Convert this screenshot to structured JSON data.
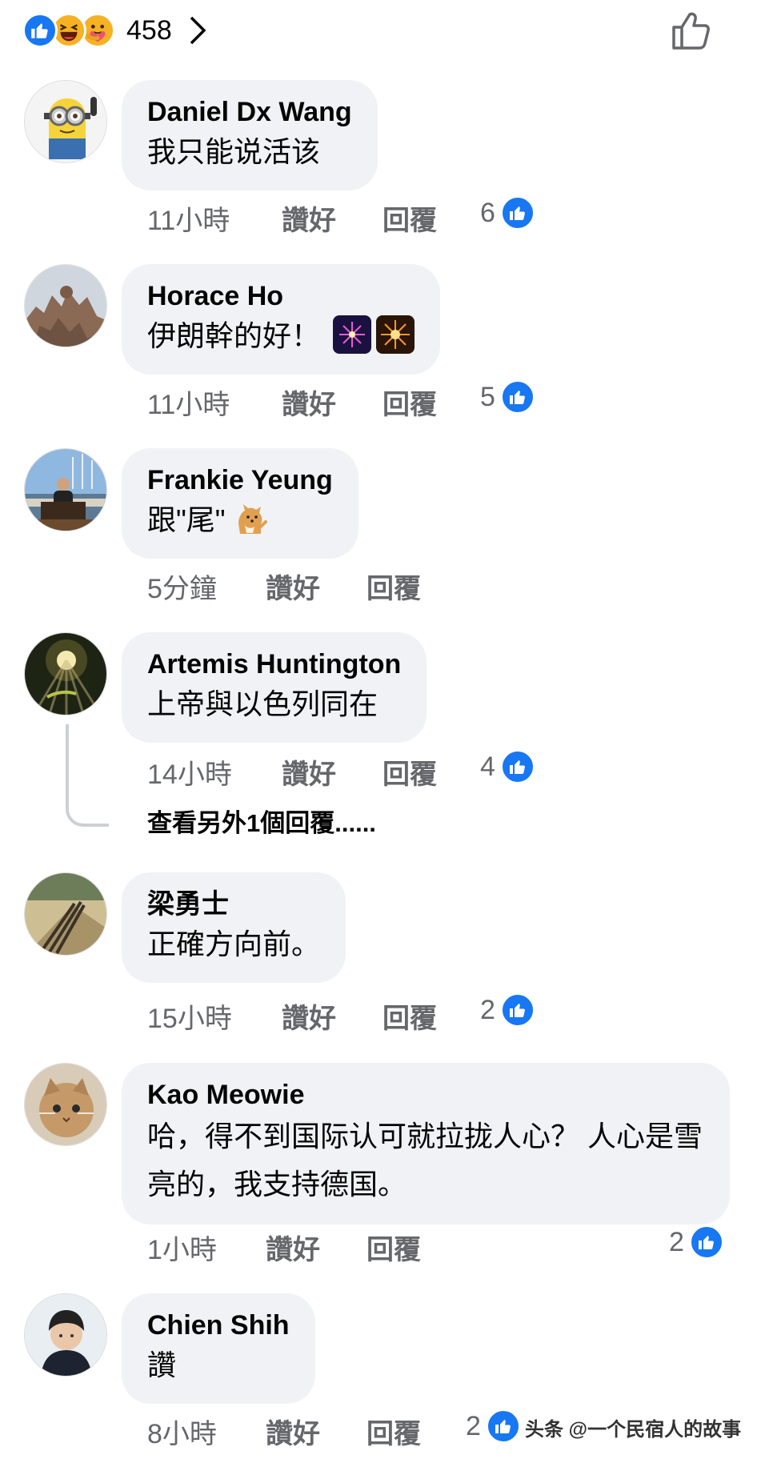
{
  "header": {
    "reaction_icons": [
      "like-icon",
      "haha-icon",
      "care-icon"
    ],
    "reaction_count": "458"
  },
  "comments": [
    {
      "author": "Daniel Dx Wang",
      "text": "我只能说活该",
      "time": "11小時",
      "like_label": "讚好",
      "reply_label": "回覆",
      "likes": "6",
      "avatar": "minion-avatar"
    },
    {
      "author": "Horace Ho",
      "text": "伊朗幹的好！",
      "emojis": [
        "fireworks-icon",
        "sparkler-icon"
      ],
      "time": "11小時",
      "like_label": "讚好",
      "reply_label": "回覆",
      "likes": "5",
      "avatar": "statue-avatar"
    },
    {
      "author": "Frankie Yeung",
      "text": "跟\"尾\"",
      "emojis": [
        "dog-icon"
      ],
      "time": "5分鐘",
      "like_label": "讚好",
      "reply_label": "回覆",
      "likes": "",
      "avatar": "harbor-avatar"
    },
    {
      "author": "Artemis Huntington",
      "text": "上帝與以色列同在",
      "time": "14小時",
      "like_label": "讚好",
      "reply_label": "回覆",
      "likes": "4",
      "avatar": "forest-sun-avatar",
      "view_more": "查看另外1個回覆......"
    },
    {
      "author": "梁勇士",
      "text": "正確方向前。",
      "time": "15小時",
      "like_label": "讚好",
      "reply_label": "回覆",
      "likes": "2",
      "avatar": "shadow-avatar"
    },
    {
      "author": "Kao Meowie",
      "text": "哈，得不到国际认可就拉拢人心？ 人心是雪亮的，我支持德国。",
      "time": "1小時",
      "like_label": "讚好",
      "reply_label": "回覆",
      "likes": "2",
      "avatar": "cat-avatar"
    },
    {
      "author": "Chien Shih",
      "text": "讚",
      "time": "8小時",
      "like_label": "讚好",
      "reply_label": "回覆",
      "likes": "2",
      "avatar": "person-avatar"
    }
  ],
  "watermark": "头条 @一个民宿人的故事",
  "colors": {
    "accent": "#1877f2",
    "bubble": "#f0f2f5",
    "meta": "#65676b"
  }
}
